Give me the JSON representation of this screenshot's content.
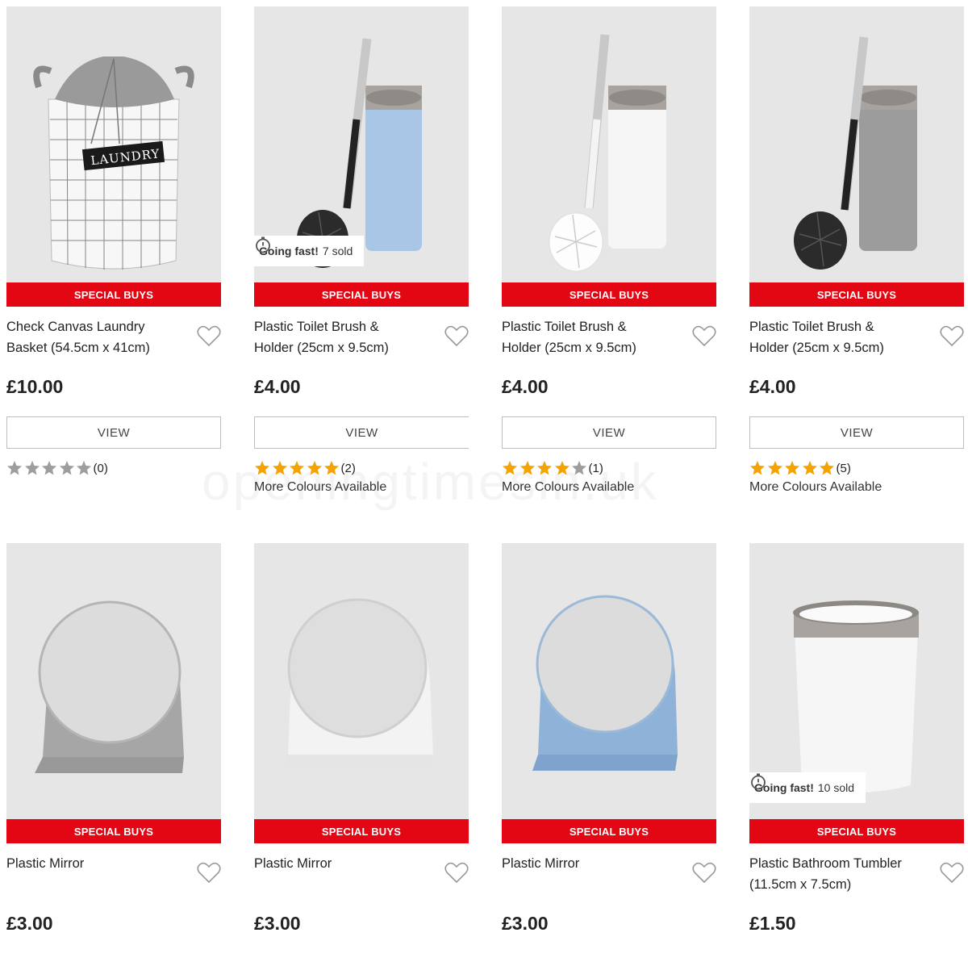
{
  "view_label": "VIEW",
  "special_label": "SPECIAL BUYS",
  "more_colours": "More Colours Available",
  "going_fast_label": "Going fast!",
  "watermark": "openingtimesin.uk",
  "products": [
    {
      "title": "Check Canvas Laundry Basket (54.5cm x 41cm)",
      "price": "£10.00",
      "rating_count": "(0)",
      "rating_stars": 0,
      "image": "laundry-basket-image",
      "more": false
    },
    {
      "title": "Plastic Toilet Brush & Holder (25cm x 9.5cm)",
      "price": "£4.00",
      "rating_count": "(2)",
      "rating_stars": 5,
      "going_fast_sold": "7 sold",
      "image": "toilet-brush-blue-image",
      "more": true
    },
    {
      "title": "Plastic Toilet Brush & Holder (25cm x 9.5cm)",
      "price": "£4.00",
      "rating_count": "(1)",
      "rating_stars": 4,
      "image": "toilet-brush-white-image",
      "more": true
    },
    {
      "title": "Plastic Toilet Brush & Holder (25cm x 9.5cm)",
      "price": "£4.00",
      "rating_count": "(5)",
      "rating_stars": 5,
      "image": "toilet-brush-grey-image",
      "more": true
    },
    {
      "title": "Plastic Mirror",
      "price": "£3.00",
      "image": "mirror-grey-image"
    },
    {
      "title": "Plastic Mirror",
      "price": "£3.00",
      "image": "mirror-white-image"
    },
    {
      "title": "Plastic Mirror",
      "price": "£3.00",
      "image": "mirror-blue-image"
    },
    {
      "title": "Plastic Bathroom Tumbler (11.5cm x 7.5cm)",
      "price": "£1.50",
      "going_fast_sold": "10 sold",
      "image": "tumbler-image"
    }
  ],
  "colors": {
    "special_red": "#e30613",
    "star_gold": "#f5a300",
    "star_grey": "#9e9e9e"
  }
}
